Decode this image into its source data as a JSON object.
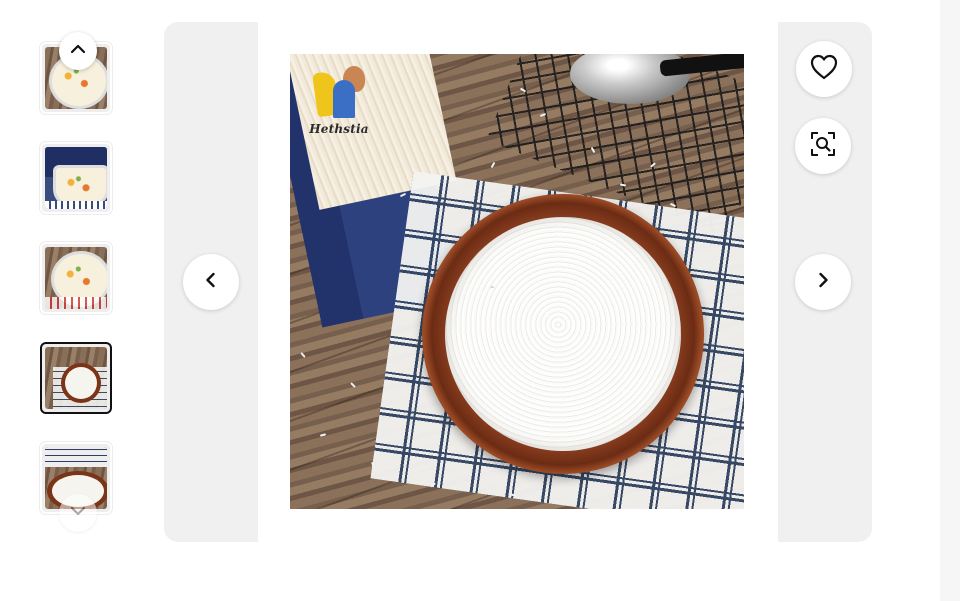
{
  "gallery": {
    "thumbnails": [
      {
        "alt": "fried-rice-bowl"
      },
      {
        "alt": "rice-bowl-with-blue-box"
      },
      {
        "alt": "fried-rice-dish"
      },
      {
        "alt": "rice-in-wooden-bowl",
        "selected": true
      },
      {
        "alt": "rice-bowl-closeup"
      }
    ],
    "selected_index": 3,
    "scroll_up_icon": "chevron-up-icon",
    "scroll_down_icon": "chevron-down-icon"
  },
  "main_image": {
    "brand_logo_text": "Hethstia",
    "prev_icon": "chevron-left-icon",
    "next_icon": "chevron-right-icon"
  },
  "actions": {
    "favorite_icon": "heart-icon",
    "visual_search_icon": "image-search-icon"
  }
}
